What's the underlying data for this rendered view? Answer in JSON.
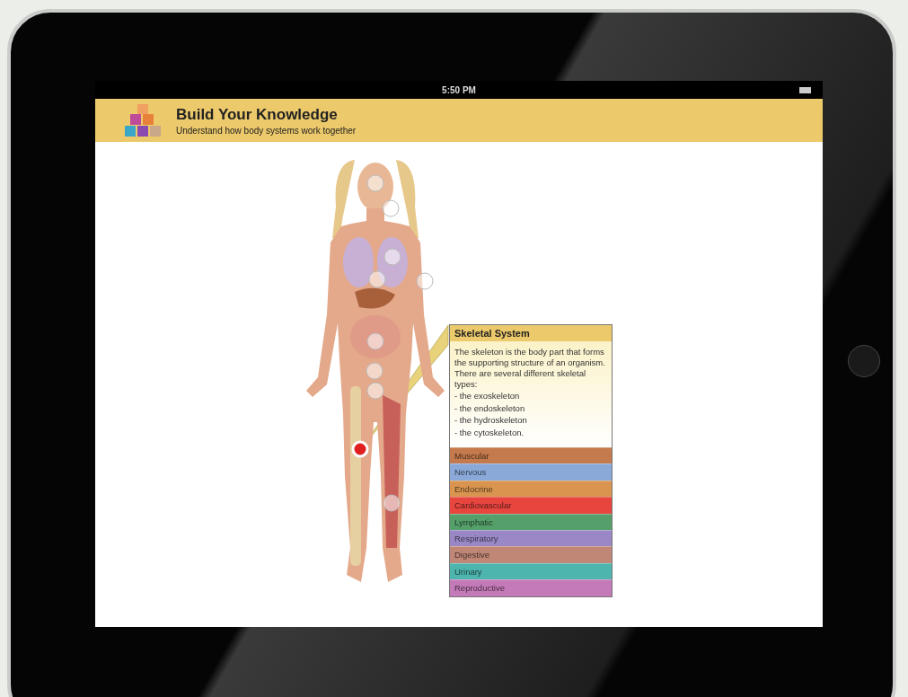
{
  "status_bar": {
    "time": "5:50 PM"
  },
  "header": {
    "title": "Build Your Knowledge",
    "subtitle": "Understand how body systems work together"
  },
  "hotspots": [
    {
      "selected": false
    },
    {
      "selected": false
    },
    {
      "selected": false
    },
    {
      "selected": false
    },
    {
      "selected": false
    },
    {
      "selected": false
    },
    {
      "selected": false
    },
    {
      "selected": false
    },
    {
      "selected": true
    },
    {
      "selected": false
    }
  ],
  "info_panel": {
    "title": "Skeletal System",
    "description": "The skeleton is the body part that forms the supporting structure of an organism. There are several different skeletal types:",
    "list": [
      "- the exoskeleton",
      "- the endoskeleton",
      "- the hydroskeleton",
      "- the cytoskeleton."
    ]
  },
  "systems": [
    {
      "label": "Muscular",
      "color": "#c47a4c"
    },
    {
      "label": "Nervous",
      "color": "#8aa9d8"
    },
    {
      "label": "Endocrine",
      "color": "#d9954f"
    },
    {
      "label": "Cardiovascular",
      "color": "#e8453f"
    },
    {
      "label": "Lymphatic",
      "color": "#55a06a"
    },
    {
      "label": "Respiratory",
      "color": "#9a88c6"
    },
    {
      "label": "Digestive",
      "color": "#c08777"
    },
    {
      "label": "Urinary",
      "color": "#4db5ae"
    },
    {
      "label": "Reproductive",
      "color": "#c47ab8"
    }
  ]
}
